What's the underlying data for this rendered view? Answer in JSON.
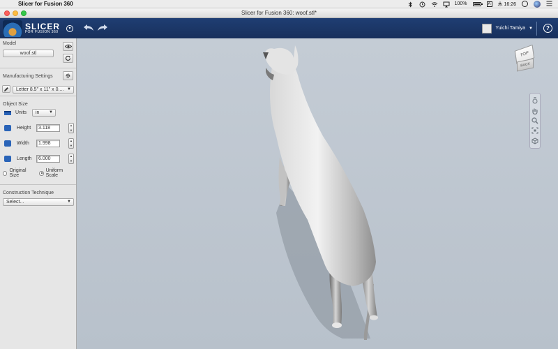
{
  "os_menubar": {
    "app_name": "Slicer for Fusion 360",
    "battery": "100%",
    "battery_level": 1.0,
    "time": "木 16:26",
    "input_source": "A"
  },
  "window": {
    "title": "Slicer for Fusion 360: woof.stl*"
  },
  "toolbar": {
    "logo_text": "SLICER",
    "logo_subtext": "FOR FUSION 360",
    "user_name": "Yuichi Tamiya",
    "help_label": "?"
  },
  "panel": {
    "model": {
      "label": "Model",
      "file_name": "woof.stl"
    },
    "manufacturing": {
      "label": "Manufacturing Settings",
      "selected": "Letter 8.5\" x 11\" x 0...."
    },
    "object_size": {
      "label": "Object Size",
      "units_label": "Units",
      "units_value": "in",
      "height_label": "Height",
      "height_value": "3.118",
      "width_label": "Width",
      "width_value": "1.998",
      "length_label": "Length",
      "length_value": "6.000",
      "original_size_label": "Original Size",
      "uniform_scale_label": "Uniform Scale"
    },
    "construction": {
      "label": "Construction Technique",
      "selected": "Select..."
    }
  },
  "viewport": {
    "viewcube_top": "TOP",
    "viewcube_front": "BACK"
  },
  "colors": {
    "toolbar_bg": "#1f3e73",
    "panel_bg": "#e6e6e6",
    "viewport_bg": "#c4ccd5",
    "dim_icon": "#2a64b8"
  }
}
